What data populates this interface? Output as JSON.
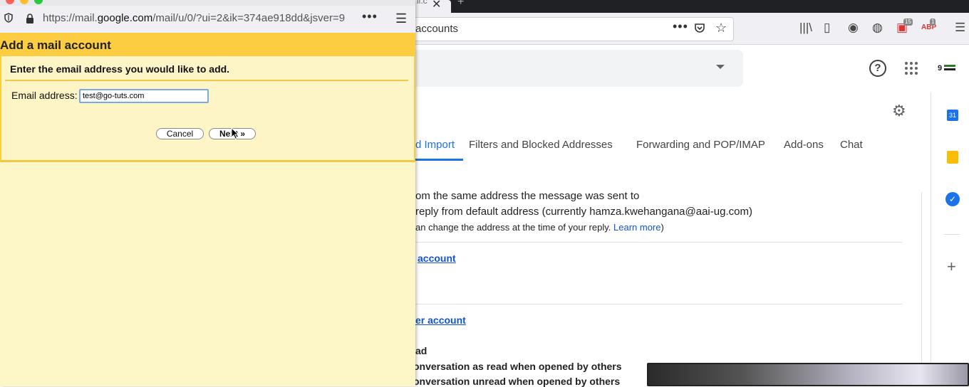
{
  "main_browser": {
    "tab_partial": "il.c",
    "url_partial": "accounts"
  },
  "gmail": {
    "tabs": [
      {
        "label": "d Import"
      },
      {
        "label": "Filters and Blocked Addresses"
      },
      {
        "label": "Forwarding and POP/IMAP"
      },
      {
        "label": "Add-ons"
      },
      {
        "label": "Chat"
      }
    ],
    "reply_line_1": "om the same address the message was sent to",
    "reply_line_2": "reply from default address (currently hamza.kwehangana@aai-ug.com)",
    "reply_line_3": "an change the address at the time of your reply.",
    "learn_more": "Learn more",
    "add_account_link": "account",
    "other_account_link": "er account",
    "read_heading": "ad",
    "mark_read": "onversation as read when opened by others",
    "mark_unread": "onversation unread when opened by others",
    "calendar_day": "31",
    "tb_badge_1": "15",
    "tb_badge_2": "1",
    "abp_label": "ABP"
  },
  "popup": {
    "url": "https://mail.google.com/mail/u/0/?ui=2&ik=374ae918dd&jsver=9",
    "url_prefix": "https://mail.",
    "url_domain": "google.com",
    "url_suffix": "/mail/u/0/?ui=2&ik=374ae918dd&jsver=9",
    "title": "Add a mail account",
    "instruction": "Enter the email address you would like to add.",
    "email_label": "Email address:",
    "email_value": "test@go-tuts.com",
    "cancel_label": "Cancel",
    "next_label": "Next »"
  },
  "colors": {
    "header_yellow": "#fccd40",
    "body_yellow": "#fef5c6",
    "link_blue": "#1155cc",
    "active_tab_blue": "#1a73e8"
  }
}
